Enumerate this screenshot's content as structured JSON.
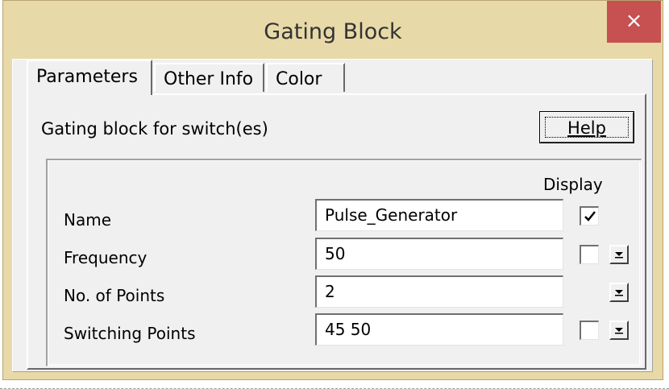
{
  "window": {
    "title": "Gating Block",
    "close_label": "×"
  },
  "tabs": [
    {
      "label": "Parameters",
      "active": true
    },
    {
      "label": "Other Info",
      "active": false
    },
    {
      "label": "Color",
      "active": false
    }
  ],
  "panel": {
    "description": "Gating block for switch(es)",
    "help_label": "Help",
    "display_header": "Display"
  },
  "params": [
    {
      "label": "Name",
      "value": "Pulse_Generator",
      "display_checkbox": true,
      "display_checked": true,
      "dropdown": false
    },
    {
      "label": "Frequency",
      "value": "50",
      "display_checkbox": true,
      "display_checked": false,
      "dropdown": true
    },
    {
      "label": "No. of Points",
      "value": "2",
      "display_checkbox": false,
      "display_checked": false,
      "dropdown": true
    },
    {
      "label": "Switching Points",
      "value": "45 50",
      "display_checkbox": true,
      "display_checked": false,
      "dropdown": true
    }
  ],
  "icons": {
    "checkmark": "checkmark-icon",
    "dropdown": "dropdown-arrow-icon",
    "close": "close-icon"
  },
  "colors": {
    "titlebar": "#e8d9a8",
    "close_button": "#c75050",
    "dialog_face": "#f0f0f0"
  }
}
